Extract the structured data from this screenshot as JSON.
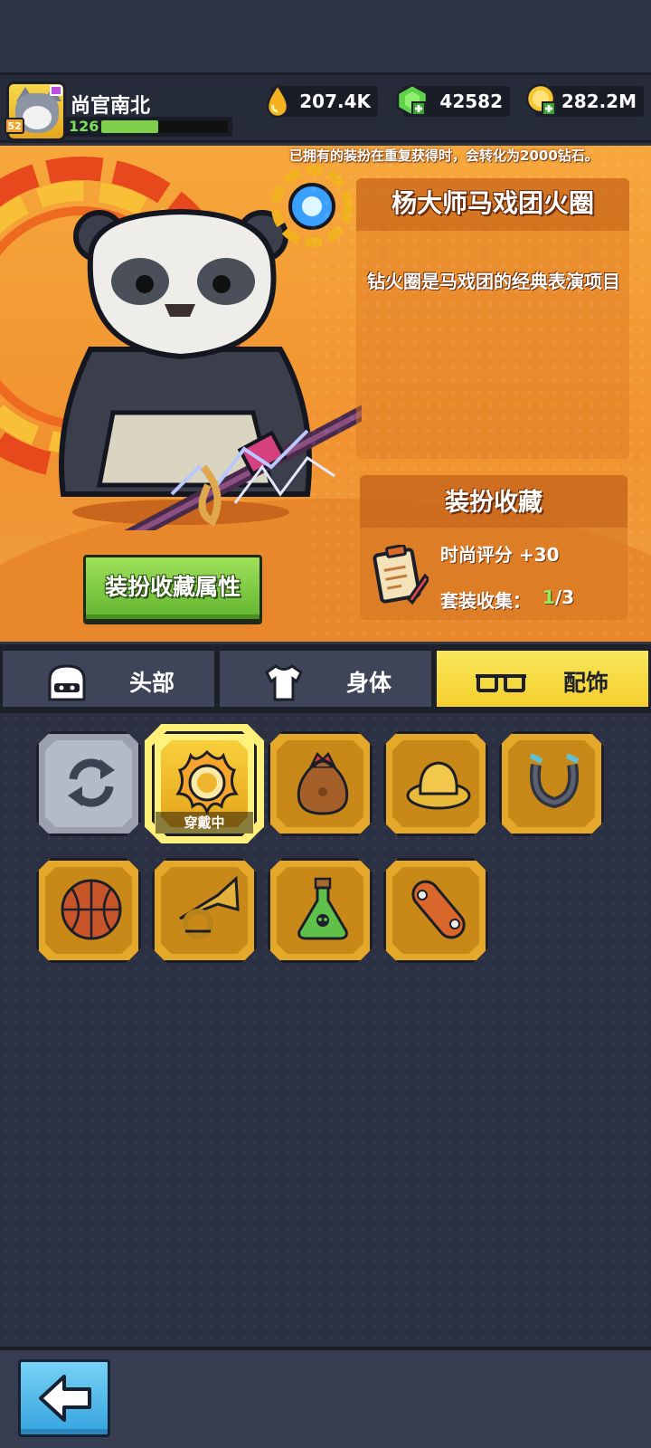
{
  "player": {
    "name": "尚官南北",
    "level": "52",
    "xp_value": "126",
    "xp_progress": 0.45
  },
  "resources": [
    {
      "name": "oil-drop",
      "value": "207.4K"
    },
    {
      "name": "green-gem",
      "value": "42582"
    },
    {
      "name": "gold-coin",
      "value": "282.2M"
    }
  ],
  "notice": "已拥有的装扮在重复获得时，会转化为2000钻石。",
  "item": {
    "title": "杨大师马戏团火圈",
    "description": "钻火圈是马戏团的经典表演项目"
  },
  "collection": {
    "title": "装扮收藏",
    "fashion_score": "时尚评分 +30",
    "set_label": "套装收集：",
    "set_current": "1",
    "set_total": "/3"
  },
  "attr_button": "装扮收藏属性",
  "tabs": [
    {
      "label": "头部",
      "icon": "helmet-icon",
      "active": false
    },
    {
      "label": "身体",
      "icon": "shirt-icon",
      "active": false
    },
    {
      "label": "配饰",
      "icon": "glasses-icon",
      "active": true
    }
  ],
  "equipped_label": "穿戴中",
  "slots": [
    {
      "icon": "refresh-icon",
      "state": "grey"
    },
    {
      "icon": "fire-ring-icon",
      "state": "equipped"
    },
    {
      "icon": "sack-icon",
      "state": "normal"
    },
    {
      "icon": "hat-icon",
      "state": "normal"
    },
    {
      "icon": "horseshoe-magnet-icon",
      "state": "normal"
    },
    {
      "icon": "basketball-icon",
      "state": "normal"
    },
    {
      "icon": "horn-icon",
      "state": "normal"
    },
    {
      "icon": "poison-flask-icon",
      "state": "normal"
    },
    {
      "icon": "skateboard-icon",
      "state": "normal"
    }
  ],
  "colors": {
    "accent_yellow": "#f5cf2e",
    "hero_orange": "#f19230",
    "button_green": "#62b52f",
    "back_blue": "#36a4df"
  }
}
